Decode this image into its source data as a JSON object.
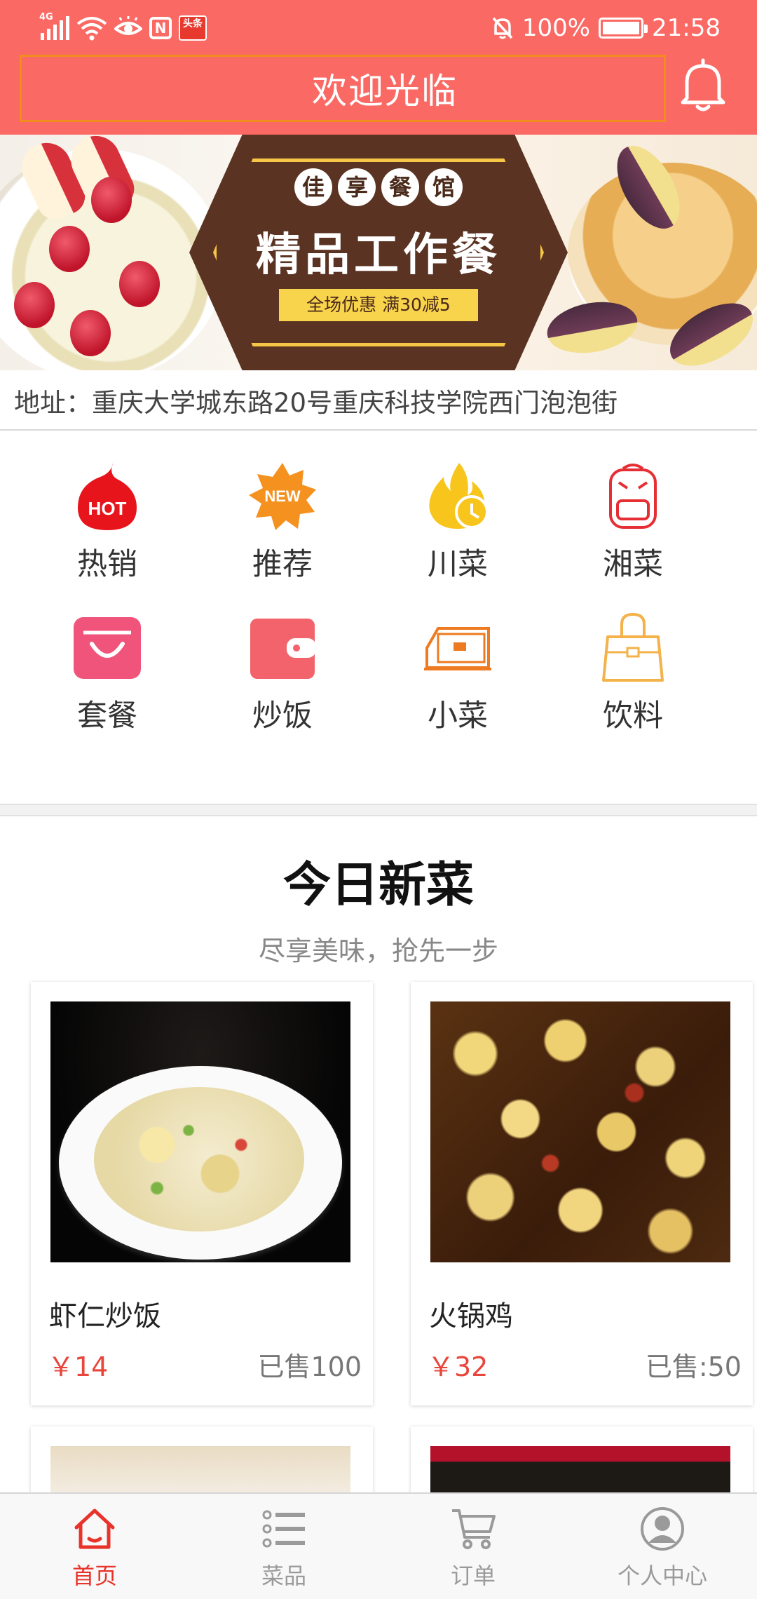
{
  "status_bar": {
    "network": "4G",
    "news_badge": "头条",
    "nfc": "N",
    "battery": "100%",
    "battery_level": 1.0,
    "time": "21:58"
  },
  "header": {
    "title": "欢迎光临",
    "bell_icon": "bell-icon",
    "background": "#fa6964"
  },
  "banner": {
    "restaurant_chars": [
      "佳",
      "享",
      "餐",
      "馆"
    ],
    "headline": "精品工作餐",
    "promo": "全场优惠 满30减5"
  },
  "address": "地址：重庆大学城东路20号重庆科技学院西门泡泡街",
  "categories": [
    {
      "label": "热销",
      "icon": "hot-icon"
    },
    {
      "label": "推荐",
      "icon": "new-icon"
    },
    {
      "label": "川菜",
      "icon": "flame-icon"
    },
    {
      "label": "湘菜",
      "icon": "backpack-icon"
    },
    {
      "label": "套餐",
      "icon": "basket-icon"
    },
    {
      "label": "炒饭",
      "icon": "wallet-icon"
    },
    {
      "label": "小菜",
      "icon": "purse-icon"
    },
    {
      "label": "饮料",
      "icon": "handbag-icon"
    }
  ],
  "new_dishes": {
    "title": "今日新菜",
    "subtitle": "尽享美味，抢先一步",
    "items": [
      {
        "name": "虾仁炒饭",
        "price": "￥14",
        "sold": "已售100"
      },
      {
        "name": "火锅鸡",
        "price": "￥32",
        "sold": "已售:50"
      }
    ]
  },
  "tabbar": [
    {
      "label": "首页",
      "icon": "home-icon",
      "active": true
    },
    {
      "label": "菜品",
      "icon": "list-icon",
      "active": false
    },
    {
      "label": "订单",
      "icon": "cart-icon",
      "active": false
    },
    {
      "label": "个人中心",
      "icon": "user-icon",
      "active": false
    }
  ],
  "colors": {
    "accent": "#fa6964",
    "price": "#e8463b",
    "tab_active": "#e8332b"
  }
}
